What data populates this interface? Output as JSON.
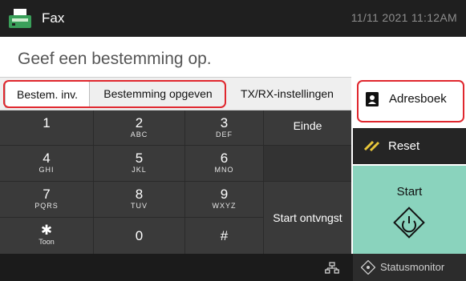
{
  "header": {
    "title": "Fax",
    "datetime": "11/11 2021 11:12AM",
    "icon": "fax-icon"
  },
  "instruction": "Geef een bestemming op.",
  "tabs": [
    {
      "label": "Bestem. inv.",
      "active": true
    },
    {
      "label": "Bestemming opgeven",
      "active": false
    },
    {
      "label": "TX/RX-instellingen",
      "active": false
    }
  ],
  "keypad": {
    "keys": [
      {
        "num": "1",
        "sub": ""
      },
      {
        "num": "2",
        "sub": "ABC"
      },
      {
        "num": "3",
        "sub": "DEF"
      },
      {
        "num": "4",
        "sub": "GHI"
      },
      {
        "num": "5",
        "sub": "JKL"
      },
      {
        "num": "6",
        "sub": "MNO"
      },
      {
        "num": "7",
        "sub": "PQRS"
      },
      {
        "num": "8",
        "sub": "TUV"
      },
      {
        "num": "9",
        "sub": "WXYZ"
      },
      {
        "num": "✱",
        "sub": "Toon"
      },
      {
        "num": "0",
        "sub": ""
      },
      {
        "num": "#",
        "sub": ""
      }
    ],
    "side": {
      "end": "Einde",
      "start_receive": "Start ontvngst"
    }
  },
  "right_panel": {
    "address_book": "Adresboek",
    "reset": "Reset",
    "start": "Start"
  },
  "footer": {
    "status_monitor": "Statusmonitor"
  },
  "colors": {
    "highlight": "#e0272e",
    "start_bg": "#8ad3bd",
    "titlebar_bg": "#1f1f1f",
    "keypad_bg": "#3a3a3a"
  }
}
